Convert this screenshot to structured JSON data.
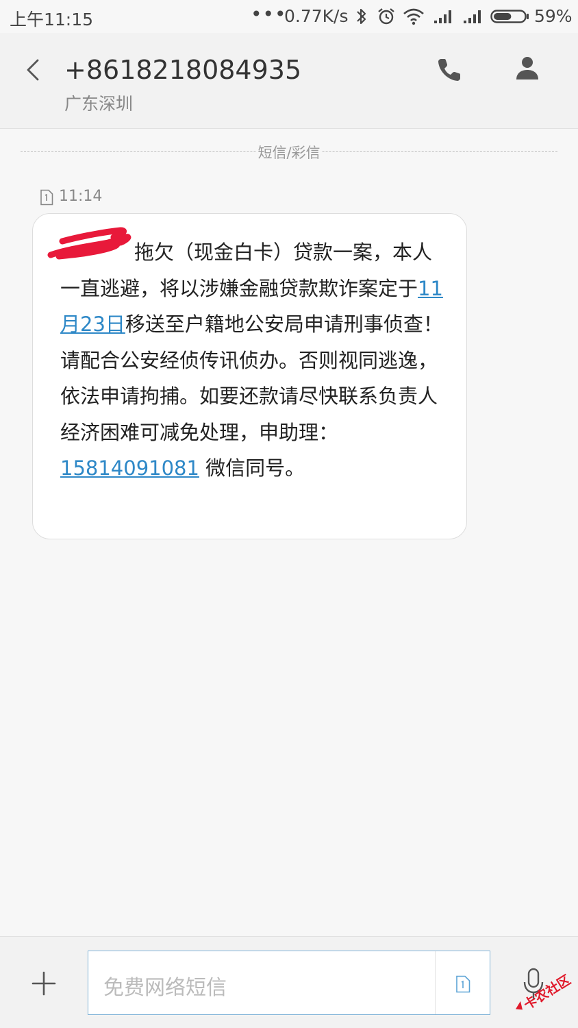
{
  "status_bar": {
    "time": "上午11:15",
    "more": "•••",
    "network_speed": "0.77K/s",
    "battery_percent": "59%",
    "battery_level": 0.59,
    "icons": [
      "bluetooth-icon",
      "alarm-icon",
      "wifi-icon",
      "signal-icon",
      "signal-icon",
      "battery-icon"
    ]
  },
  "header": {
    "number": "+8618218084935",
    "location": "广东深圳",
    "icons": [
      "back-arrow-icon",
      "phone-icon",
      "person-icon"
    ]
  },
  "thread": {
    "divider_label": "短信/彩信",
    "message": {
      "time": "11:14",
      "redacted_prefix": "",
      "text_part1": "拖欠（现金白卡）贷款一案，本人一直逃避，将以涉嫌金融贷款欺诈案定于",
      "link_date": "11月23日",
      "text_part2": "移送至户籍地公安局申请刑事侦查！请配合公安经侦传讯侦办。否则视同逃逸，依法申请拘捕。如要还款请尽快联系负责人经济困难可减免处理，申助理：",
      "link_phone": "15814091081",
      "text_part3": " 微信同号。"
    }
  },
  "input_bar": {
    "placeholder": "免费网络短信",
    "icons": [
      "plus-icon",
      "sim-card-icon",
      "microphone-icon"
    ]
  },
  "watermark": {
    "text": "卡农社区"
  },
  "colors": {
    "link": "#2e88c7",
    "input_border": "#7fb2d8",
    "redaction": "#e8193a",
    "watermark": "#e01a2b"
  }
}
